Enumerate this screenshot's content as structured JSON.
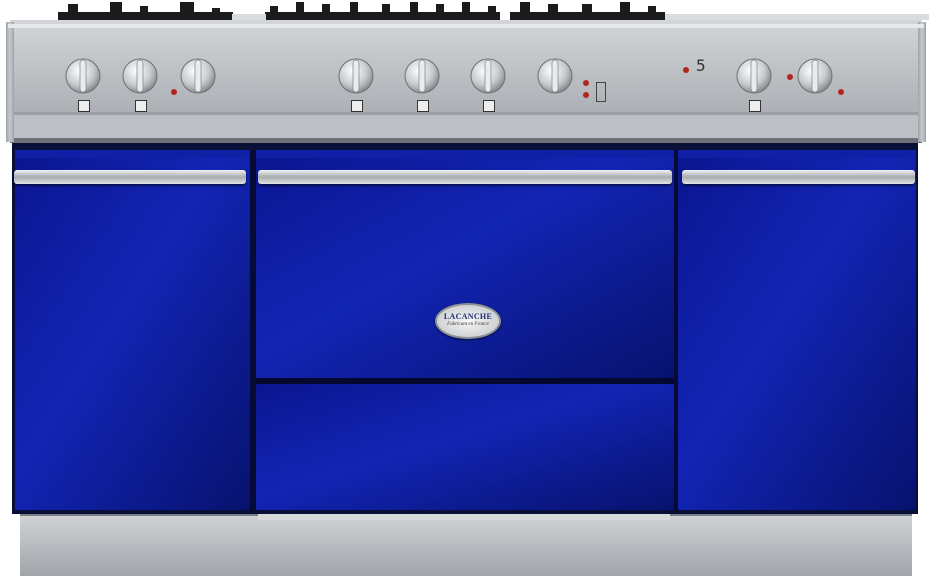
{
  "colors": {
    "enamel": "#0c1a9e",
    "enamel_dark": "#06106a",
    "steel": "#b9bcc0",
    "steel_dark": "#8d9196",
    "grate": "#1b1b1d",
    "indicator": "#b3261e"
  },
  "cooktop": {
    "grate_count": 5
  },
  "control_panel": {
    "knobs": [
      {
        "id": "knob-1",
        "label_icon": "burner-square-icon"
      },
      {
        "id": "knob-2",
        "label_icon": "burner-square-icon"
      },
      {
        "id": "knob-3",
        "label_icon": "oven-icon"
      },
      {
        "id": "knob-4",
        "label_icon": "burner-square-icon"
      },
      {
        "id": "knob-5",
        "label_icon": "burner-square-icon"
      },
      {
        "id": "knob-6",
        "label_icon": "burner-square-icon"
      },
      {
        "id": "knob-7",
        "label_icon": "oven-icon"
      },
      {
        "id": "knob-8",
        "label_icon": "burner-square-icon"
      },
      {
        "id": "knob-9",
        "label_icon": "oven-icon"
      }
    ],
    "timer_digit": "5"
  },
  "doors": {
    "center_badge": {
      "brand": "LACANCHE",
      "tagline": "Fabricant en France"
    }
  }
}
